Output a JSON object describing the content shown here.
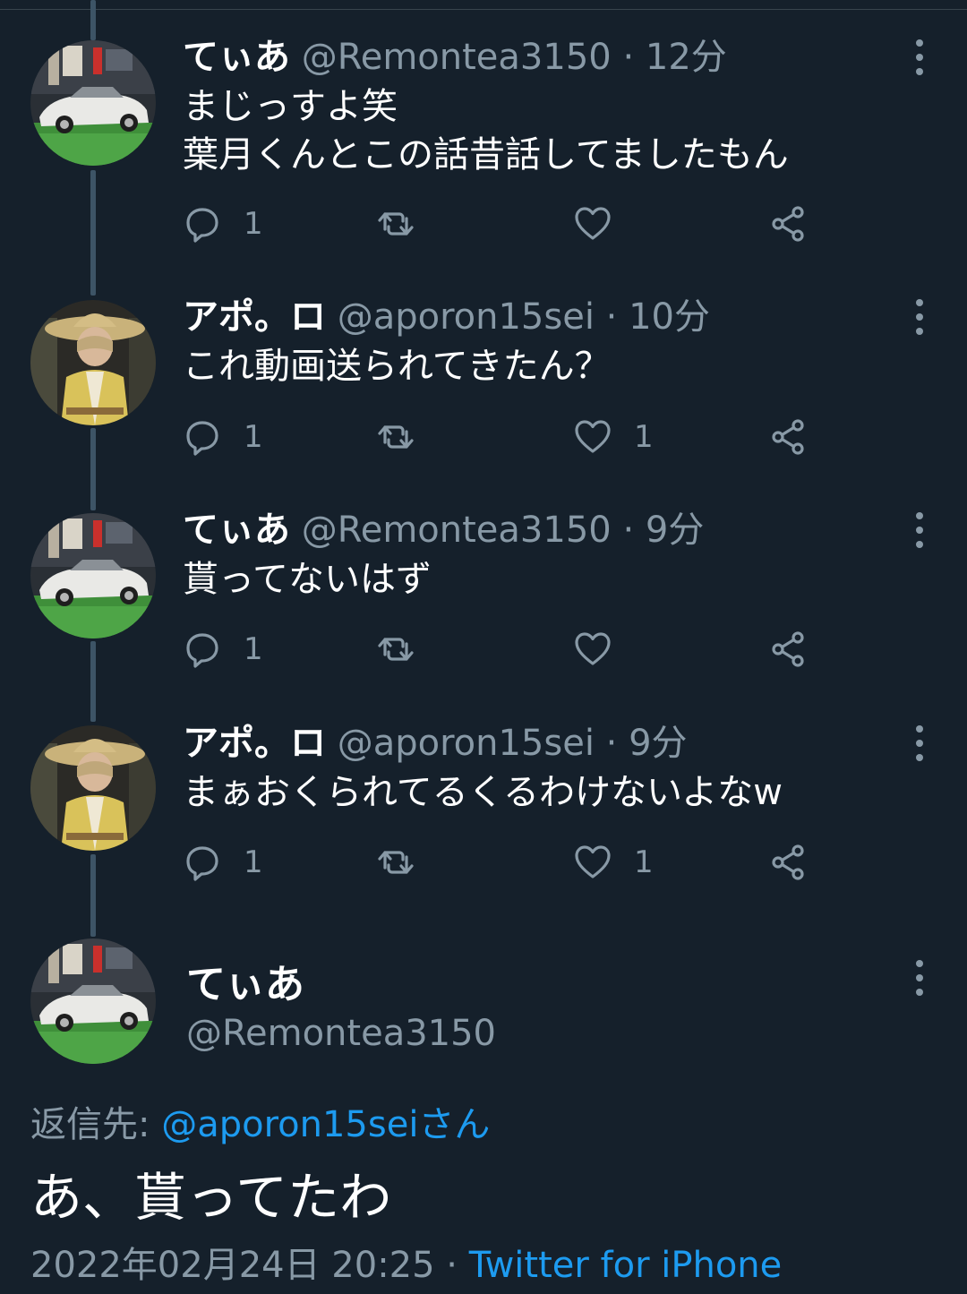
{
  "tweets": [
    {
      "name": "てぃあ",
      "handle": "@Remontea3150",
      "time": "12分",
      "text": "まじっすよ笑\n葉月くんとこの話昔話してましたもん",
      "replies": "1",
      "retweets": "",
      "likes": "",
      "avatar": "car"
    },
    {
      "name": "アポ。ロ",
      "handle": "@aporon15sei",
      "time": "10分",
      "text": "これ動画送られてきたん？",
      "replies": "1",
      "retweets": "",
      "likes": "1",
      "avatar": "person"
    },
    {
      "name": "てぃあ",
      "handle": "@Remontea3150",
      "time": "9分",
      "text": "貰ってないはず",
      "replies": "1",
      "retweets": "",
      "likes": "",
      "avatar": "car"
    },
    {
      "name": "アポ。ロ",
      "handle": "@aporon15sei",
      "time": "9分",
      "text": "まぁおくられてるくるわけないよなw",
      "replies": "1",
      "retweets": "",
      "likes": "1",
      "avatar": "person"
    }
  ],
  "focus": {
    "name": "てぃあ",
    "handle": "@Remontea3150",
    "reply_label": "返信先: ",
    "reply_to": "@aporon15seiさん",
    "text": "あ、貰ってたわ",
    "date": "2022年02月24日 20:25",
    "separator": " · ",
    "source": "Twitter for iPhone"
  },
  "icons": {
    "reply": "reply-icon",
    "retweet": "retweet-icon",
    "like": "heart-icon",
    "share": "share-icon",
    "more": "more-vertical-icon"
  },
  "colors": {
    "background": "#15202b",
    "muted": "#8899a6",
    "link": "#1d9bf0",
    "thread": "#3d5466"
  }
}
